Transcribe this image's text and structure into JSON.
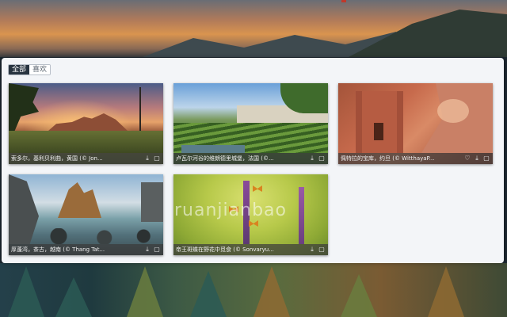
{
  "tabs": [
    {
      "label": "全部",
      "active": true
    },
    {
      "label": "喜欢",
      "active": false
    }
  ],
  "wallpapers": [
    {
      "caption": "索多尔，基利贝利曲，黄国 (© Jon...",
      "icons": [
        "download-icon",
        "fullscreen-icon"
      ]
    },
    {
      "caption": "卢瓦尔河谷的维朗德里城堡，法国 (©...",
      "icons": [
        "download-icon",
        "fullscreen-icon"
      ]
    },
    {
      "caption": "佩特拉的宝库，约旦 (© WitthayaP...",
      "icons": [
        "heart-icon",
        "download-icon",
        "fullscreen-icon"
      ]
    },
    {
      "caption": "厚蓬湾，茶古，越南 (© Thang Tat...",
      "icons": [
        "download-icon",
        "fullscreen-icon"
      ]
    },
    {
      "caption": "帝王斑蝶在野花中觅食 (© Sonvaryu...",
      "icons": [
        "download-icon",
        "fullscreen-icon"
      ]
    }
  ],
  "watermark": "ruanjianbao"
}
